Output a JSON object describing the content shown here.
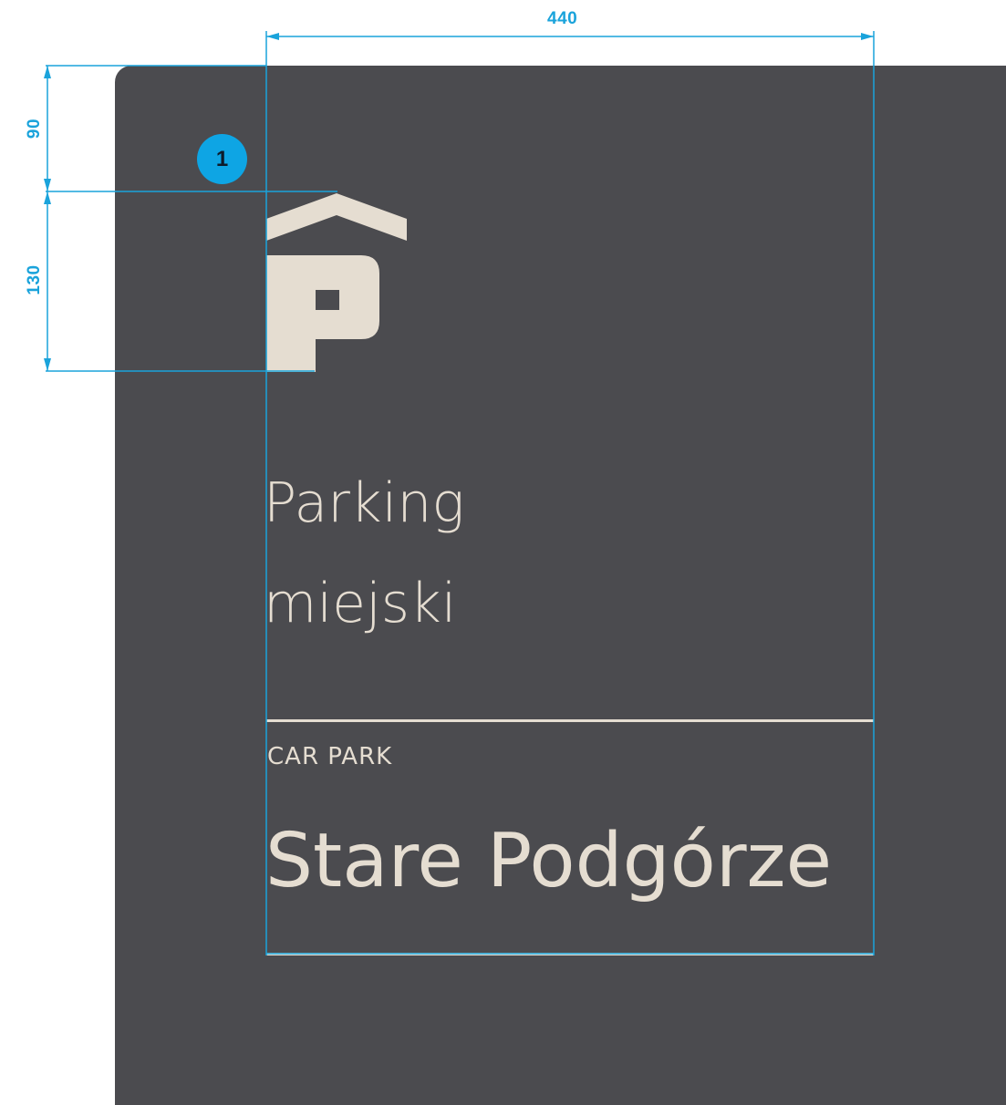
{
  "dimensions": {
    "width_label": "440",
    "top_margin_label": "90",
    "logo_height_label": "130",
    "line_color": "#1aa3db"
  },
  "marker": {
    "label": "1"
  },
  "sign": {
    "logo_icon": "parking-roof-p-icon",
    "title_line1": "Parking",
    "title_line2": "miejski",
    "subtitle": "CAR PARK",
    "location": "Stare Podgórze",
    "panel_color": "#4b4b4f",
    "text_color": "#e5ddd1"
  }
}
